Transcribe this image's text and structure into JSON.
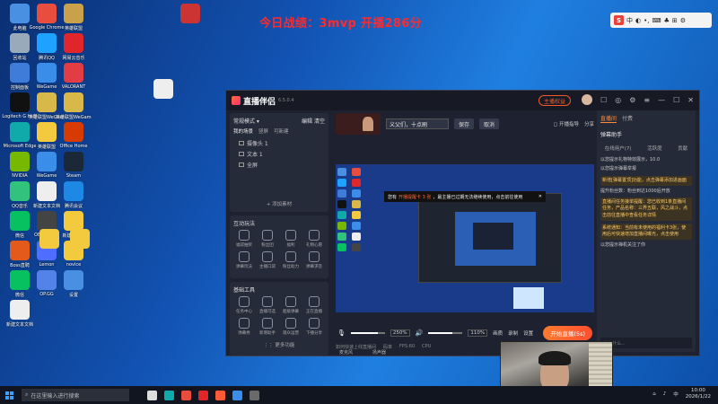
{
  "overlay_title": "今日战绩：3mvp 开播286分",
  "ime": {
    "mode": "中",
    "icons": [
      "moon-icon",
      "dot-icon",
      "keyboard-icon",
      "shirt-icon",
      "grid-icon",
      "settings-icon"
    ]
  },
  "desktop_icons": [
    {
      "label": "此电脑",
      "color": "#4a90e2"
    },
    {
      "label": "Google Chrome",
      "color": "#e84d3d"
    },
    {
      "label": "英雄联盟",
      "color": "#c9a14a"
    },
    {
      "label": "回收站",
      "color": "#9ab"
    },
    {
      "label": "腾讯QQ",
      "color": "#1ea2ff"
    },
    {
      "label": "网易云音乐",
      "color": "#e0262b"
    },
    {
      "label": "控制面板",
      "color": "#3f7bd9"
    },
    {
      "label": "WeGame",
      "color": "#3a8eea"
    },
    {
      "label": "VALORANT",
      "color": "#e23c44"
    },
    {
      "label": "Logitech G HUB",
      "color": "#111"
    },
    {
      "label": "英雄联盟WeGame版",
      "color": "#d9b84a"
    },
    {
      "label": "英雄联盟WeGame版",
      "color": "#d9b84a"
    },
    {
      "label": "Microsoft Edge",
      "color": "#1aa"
    },
    {
      "label": "英雄联盟",
      "color": "#f3c93d"
    },
    {
      "label": "Office Home",
      "color": "#d83b01"
    },
    {
      "label": "NVIDIA",
      "color": "#76b900"
    },
    {
      "label": "WeGame",
      "color": "#3a8eea"
    },
    {
      "label": "Steam",
      "color": "#1b2838"
    },
    {
      "label": "QQ音乐",
      "color": "#31c27c"
    },
    {
      "label": "新建文本文档",
      "color": "#eee"
    },
    {
      "label": "腾讯会议",
      "color": "#1e88e5"
    },
    {
      "label": "微信",
      "color": "#07c160"
    },
    {
      "label": "OBS Studio",
      "color": "#444"
    },
    {
      "label": "新建文件夹",
      "color": "#f3c93d"
    },
    {
      "label": "Boss直聘",
      "color": "#e35a1b"
    },
    {
      "label": "Lemon",
      "color": "#4f6dff"
    },
    {
      "label": "novice",
      "color": "#f3c93d"
    },
    {
      "label": "微信",
      "color": "#07c160"
    },
    {
      "label": "OP.GG",
      "color": "#5383e8"
    },
    {
      "label": "设置",
      "color": "#4a90e2"
    },
    {
      "label": "新建文本文档",
      "color": "#eee"
    }
  ],
  "app": {
    "name": "直播伴侣",
    "version": "6.5.0.4",
    "live_button": "主播权益",
    "mode_label": "常规模式",
    "edit_label": "编辑",
    "clear_label": "清空",
    "scene": {
      "tabs": [
        "我的场景",
        "竖屏",
        "可新建"
      ],
      "items": [
        "摄像头 1",
        "文本 1",
        "全屏"
      ],
      "add_label": "+ 添加素材"
    },
    "interact_title": "互动玩法",
    "interact_items": [
      "福袋抽奖",
      "粉丝团",
      "福利",
      "礼物心愿",
      "弹幕玩法",
      "主播口袋",
      "粉丝助力",
      "弹幕求签"
    ],
    "tools_title": "基础工具",
    "tools_items": [
      "任务中心",
      "直播可选",
      "超级弹幕",
      "正在直播",
      "弹幕秀",
      "新增助手",
      "观众运营",
      "下播分享"
    ],
    "more_label": "更多功能",
    "scene_input": "义父们，十点刷",
    "save_label": "保存",
    "cancel_label": "取消",
    "top_right": {
      "label": "开播指导",
      "share": "分享"
    },
    "preview_tip": {
      "left": "您有",
      "red": "开播提醒卡 3 张",
      "mid": "，最主播已过期无法继续使用，点击前往使用"
    },
    "mic_pct": "250%",
    "speaker_pct": "110%",
    "mic_label": "麦克风",
    "speaker_label": "扬声器",
    "ctrl_labels": [
      "画质",
      "录制",
      "设置"
    ],
    "go_live": "开始直播(5s)",
    "status": [
      "如何快速上线直播间",
      "码率",
      "FPS:60",
      "CPU"
    ],
    "right": {
      "tabs": [
        "直播间",
        "付费"
      ],
      "assistant_title": "弹幕助手",
      "subtabs": [
        "在线用户(7)",
        "活跃度",
        "贡献"
      ],
      "messages": [
        "以您提示礼物特效展示，10.0",
        "以您提示弹幕举报",
        "新增[弹幕置顶]功能，点击弹幕添加进画面",
        "提升粉丝数：粉丝到达1000后开放",
        "直播间任务接单提醒：您已收到1条直播间任务，产品名称：三界五联，风之战斗，点击前往直播中查看任务详情",
        "系统通知：当前有未使用的福利卡3张，使用后可快速增加直播间曝光，点击使用",
        "以您提示禅机关注了你"
      ],
      "input_placeholder": "说点什么..."
    }
  },
  "taskbar": {
    "search_placeholder": "在这里输入进行搜索",
    "time": "10:00",
    "date": "2026/1/22",
    "lang": "中"
  }
}
